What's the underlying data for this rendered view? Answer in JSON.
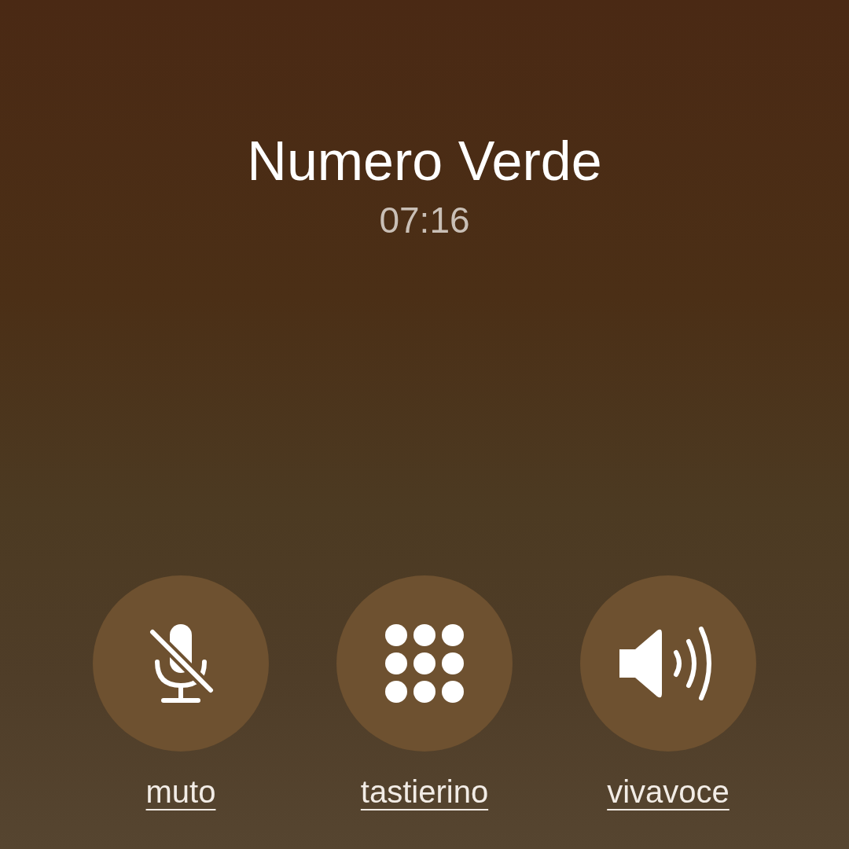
{
  "caller": {
    "name": "Numero Verde",
    "duration": "07:16"
  },
  "controls": [
    {
      "kind": "mute",
      "label": "muto"
    },
    {
      "kind": "keypad",
      "label": "tastierino"
    },
    {
      "kind": "speaker",
      "label": "vivavoce"
    }
  ]
}
